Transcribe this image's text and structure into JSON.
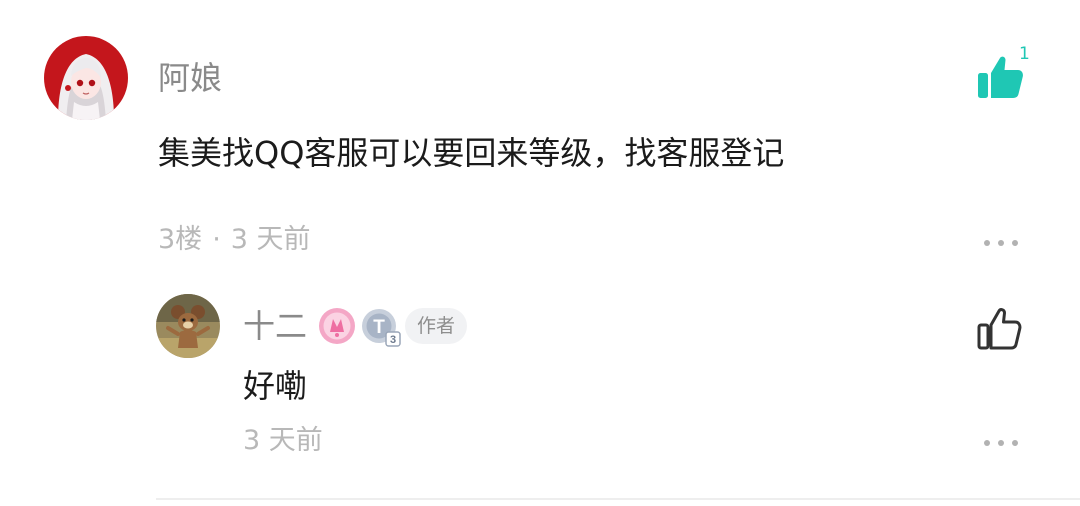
{
  "comment": {
    "author": "阿娘",
    "content": "集美找QQ客服可以要回来等级，找客服登记",
    "floor": "3楼",
    "separator": "·",
    "time": "3 天前",
    "like_count": "1",
    "like_icon": "thumbs-up-filled-icon",
    "accent_color": "#1fc7b4"
  },
  "reply": {
    "author": "十二",
    "author_tag": "作者",
    "level_badge": "T",
    "level_badge_number": "3",
    "content": "好嘞",
    "time": "3 天前",
    "like_icon": "thumbs-up-outline-icon"
  }
}
